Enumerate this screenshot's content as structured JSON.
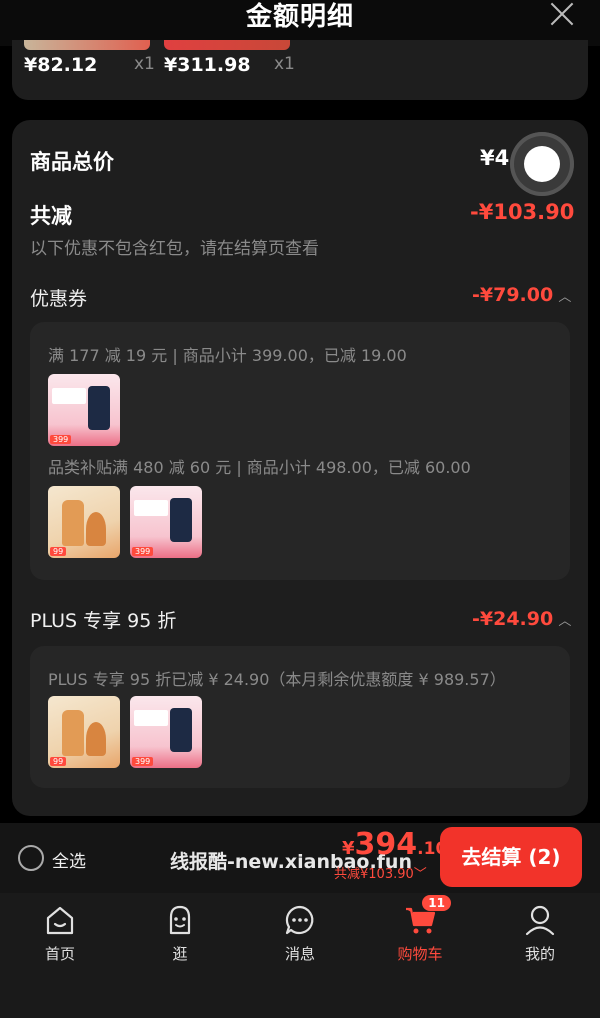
{
  "header": {
    "title": "金额明细"
  },
  "top_items": [
    {
      "price": "¥82.12",
      "qty": "x1"
    },
    {
      "price": "¥311.98",
      "qty": "x1"
    }
  ],
  "summary": {
    "goods_total_label": "商品总价",
    "goods_total_value": "¥4",
    "discount_label": "共减",
    "discount_value": "-¥103.90",
    "note": "以下优惠不包含红包，请在结算页查看"
  },
  "coupon": {
    "label": "优惠券",
    "amount": "-¥79.00",
    "rule1": "满 177 减 19 元 | 商品小计 399.00，已减 19.00",
    "rule2": "品类补贴满 480 减 60 元 | 商品小计 498.00，已减 60.00"
  },
  "plus": {
    "label": "PLUS 专享 95 折",
    "amount": "-¥24.90",
    "rule": "PLUS 专享 95 折已减 ¥ 24.90（本月剩余优惠额度 ¥ 989.57）"
  },
  "products": {
    "a_badge": "99",
    "b_badge": "399"
  },
  "checkout": {
    "select_all": "全选",
    "watermark": "线报酷-new.xianbao.fun",
    "total_symbol": "¥",
    "total_int": "394",
    "total_dec": ".10",
    "total_discount": "共减¥103.90",
    "button": "去结算 (2)"
  },
  "tabs": [
    {
      "label": "首页",
      "icon": "home-icon"
    },
    {
      "label": "逛",
      "icon": "browse-icon"
    },
    {
      "label": "消息",
      "icon": "message-icon"
    },
    {
      "label": "购物车",
      "icon": "cart-icon",
      "badge": "11",
      "active": true
    },
    {
      "label": "我的",
      "icon": "profile-icon"
    }
  ],
  "colors": {
    "accent": "#ff4a3d",
    "button": "#f2332a",
    "card": "#1e1e1e"
  }
}
